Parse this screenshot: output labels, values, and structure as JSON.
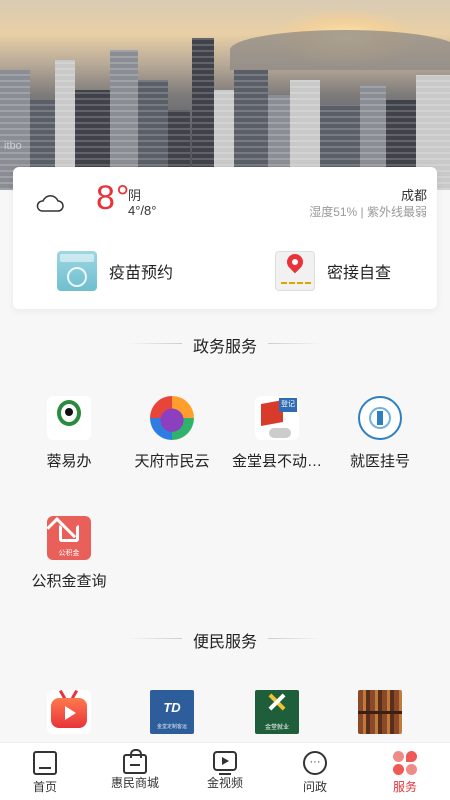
{
  "weather": {
    "temperature": "8°",
    "condition": "阴",
    "range": "4°/8°",
    "city": "成都",
    "details": "湿度51% | 紫外线最弱",
    "icon": "cloud-icon"
  },
  "hero": {
    "watermark": "itbo"
  },
  "quick_actions": [
    {
      "label": "疫苗预约",
      "icon": "vaccine-icon",
      "icon_text": "新冠疫苗"
    },
    {
      "label": "密接自查",
      "icon": "map-pin-icon"
    }
  ],
  "gov_section": {
    "title": "政务服务",
    "items": [
      {
        "label": "蓉易办",
        "icon": "panda-icon",
        "icon_text": "天府蓉易办"
      },
      {
        "label": "天府市民云",
        "icon": "citizen-cloud-icon"
      },
      {
        "label": "金堂县不动…",
        "icon": "house-registration-icon",
        "icon_text": "登记"
      },
      {
        "label": "就医挂号",
        "icon": "hospital-icon"
      },
      {
        "label": "公积金查询",
        "icon": "housing-fund-icon",
        "icon_text": "公积金"
      }
    ]
  },
  "convenience_section": {
    "title": "便民服务",
    "items": [
      {
        "label": "",
        "icon": "tv-icon"
      },
      {
        "label": "",
        "icon": "td-icon",
        "icon_text": "TD",
        "icon_sub": "金堂定制客运"
      },
      {
        "label": "",
        "icon": "job-icon",
        "icon_text": "金堂就业"
      },
      {
        "label": "",
        "icon": "library-icon"
      }
    ]
  },
  "tabbar": {
    "tabs": [
      {
        "label": "首页",
        "icon": "home-icon"
      },
      {
        "label": "惠民商城",
        "icon": "shopping-bag-icon"
      },
      {
        "label": "金视频",
        "icon": "video-icon"
      },
      {
        "label": "问政",
        "icon": "chat-icon"
      },
      {
        "label": "服务",
        "icon": "services-icon",
        "active": true
      }
    ]
  },
  "colors": {
    "accent": "#e8333a",
    "text": "#222222",
    "muted": "#999999",
    "background": "#f7f7f7"
  }
}
